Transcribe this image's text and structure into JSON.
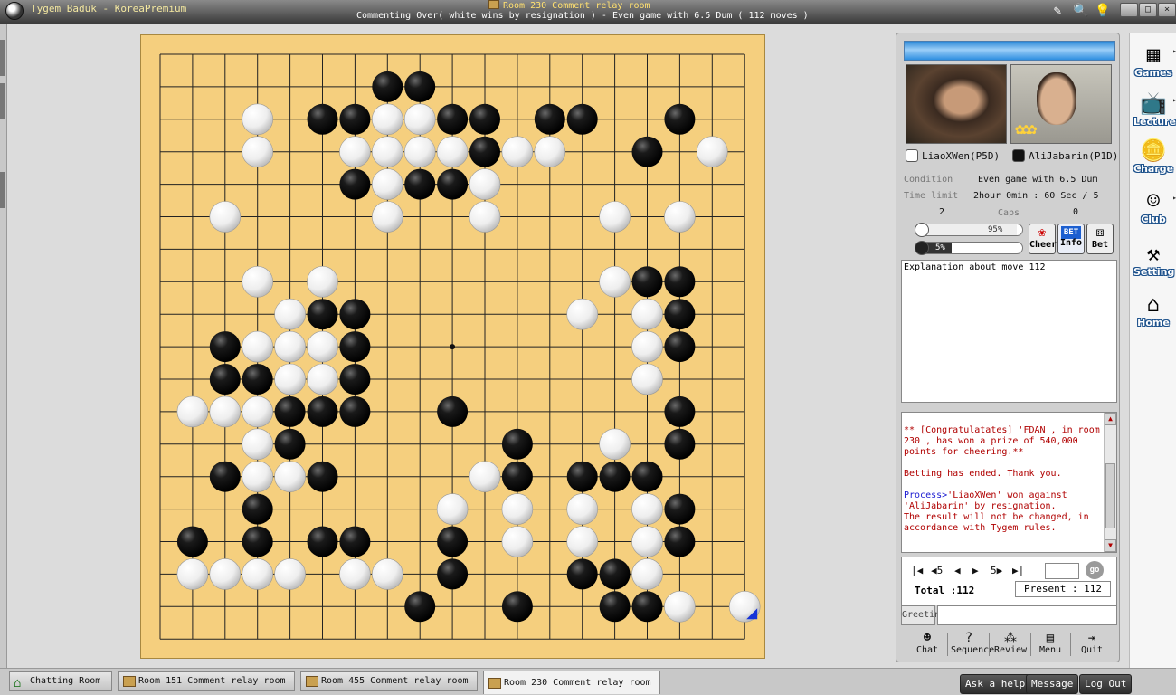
{
  "window": {
    "app_title": "Tygem Baduk - KoreaPremium",
    "room_title": "Room 230 Comment relay room",
    "status": "Commenting Over( white wins by resignation ) - Even game with 6.5 Dum  ( 112 moves )"
  },
  "players": {
    "white": {
      "name": "LiaoXWen(P5D)",
      "captures": "2",
      "cheer_pct": "95%"
    },
    "black": {
      "name": "AliJabarin(P1D)",
      "captures": "0",
      "cheer_pct": "5%"
    }
  },
  "info": {
    "condition_label": "Condition",
    "condition_value": "Even game with 6.5 Dum",
    "time_label": "Time limit",
    "time_value": "2hour 0min : 60 Sec / 5",
    "caps_label": "Caps"
  },
  "side_buttons": {
    "cheer": "Cheer",
    "info": "Info",
    "bet": "Bet",
    "bet_badge": "BET"
  },
  "explanation": "Explanation about move 112",
  "chat": {
    "line1": "** [Congratulatates] 'FDAN', in room 230 , has won a prize of 540,000 points for cheering.**",
    "line2": "Betting has ended. Thank you.",
    "process_label": "Process>",
    "line3": "'LiaoXWen' won against 'AliJabarin' by resignation.",
    "line4": "The result will not be changed, in accordance with Tygem rules."
  },
  "nav": {
    "first": "|◀",
    "back5": "◀5",
    "back": "◀",
    "fwd": "▶",
    "fwd5": "5▶",
    "last": "▶|",
    "go": "go",
    "total": "Total :112",
    "present": "Present : 112"
  },
  "greeting": {
    "label": "Greeting"
  },
  "bottom_buttons": [
    "Chat",
    "Sequence",
    "Review",
    "Menu",
    "Quit"
  ],
  "menu": [
    "Games",
    "Lecture",
    "Charge",
    "Club",
    "Setting",
    "Home"
  ],
  "tabs": [
    "Chatting Room",
    "Room 151 Comment relay room",
    "Room 455 Comment relay room",
    "Room 230 Comment relay room"
  ],
  "tab_active": "Room 230 Comment relay room",
  "right_buttons": [
    "Ask a help",
    "Message",
    "Log Out"
  ],
  "icons": {
    "app": "baduk-stone-icon",
    "pen": "pen-icon",
    "search": "search-icon",
    "tip": "lightbulb-icon"
  },
  "colors": {
    "board": "#f5cf7e",
    "header_blue": "#2e8ad8",
    "chat_red": "#b00000",
    "chat_blue": "#1a1ad0"
  },
  "board": {
    "size": 19,
    "black": [
      [
        7,
        1
      ],
      [
        8,
        1
      ],
      [
        5,
        2
      ],
      [
        6,
        2
      ],
      [
        9,
        2
      ],
      [
        10,
        2
      ],
      [
        12,
        2
      ],
      [
        13,
        2
      ],
      [
        16,
        2
      ],
      [
        10,
        3
      ],
      [
        15,
        3
      ],
      [
        6,
        4
      ],
      [
        8,
        4
      ],
      [
        9,
        4
      ],
      [
        15,
        7
      ],
      [
        16,
        7
      ],
      [
        5,
        8
      ],
      [
        6,
        8
      ],
      [
        16,
        8
      ],
      [
        2,
        9
      ],
      [
        6,
        9
      ],
      [
        16,
        9
      ],
      [
        2,
        10
      ],
      [
        3,
        10
      ],
      [
        6,
        10
      ],
      [
        4,
        11
      ],
      [
        5,
        11
      ],
      [
        6,
        11
      ],
      [
        9,
        11
      ],
      [
        16,
        11
      ],
      [
        4,
        12
      ],
      [
        11,
        12
      ],
      [
        16,
        12
      ],
      [
        2,
        13
      ],
      [
        5,
        13
      ],
      [
        11,
        13
      ],
      [
        13,
        13
      ],
      [
        14,
        13
      ],
      [
        15,
        13
      ],
      [
        3,
        14
      ],
      [
        16,
        14
      ],
      [
        1,
        15
      ],
      [
        3,
        15
      ],
      [
        5,
        15
      ],
      [
        6,
        15
      ],
      [
        9,
        15
      ],
      [
        16,
        15
      ],
      [
        9,
        16
      ],
      [
        13,
        16
      ],
      [
        14,
        16
      ],
      [
        8,
        17
      ],
      [
        11,
        17
      ],
      [
        14,
        17
      ],
      [
        15,
        17
      ]
    ],
    "white": [
      [
        3,
        2
      ],
      [
        7,
        2
      ],
      [
        8,
        2
      ],
      [
        3,
        3
      ],
      [
        6,
        3
      ],
      [
        7,
        3
      ],
      [
        8,
        3
      ],
      [
        9,
        3
      ],
      [
        11,
        3
      ],
      [
        12,
        3
      ],
      [
        17,
        3
      ],
      [
        7,
        4
      ],
      [
        10,
        4
      ],
      [
        2,
        5
      ],
      [
        7,
        5
      ],
      [
        10,
        5
      ],
      [
        14,
        5
      ],
      [
        16,
        5
      ],
      [
        3,
        7
      ],
      [
        5,
        7
      ],
      [
        14,
        7
      ],
      [
        4,
        8
      ],
      [
        13,
        8
      ],
      [
        15,
        8
      ],
      [
        3,
        9
      ],
      [
        4,
        9
      ],
      [
        5,
        9
      ],
      [
        15,
        9
      ],
      [
        4,
        10
      ],
      [
        5,
        10
      ],
      [
        15,
        10
      ],
      [
        1,
        11
      ],
      [
        2,
        11
      ],
      [
        3,
        11
      ],
      [
        3,
        12
      ],
      [
        14,
        12
      ],
      [
        3,
        13
      ],
      [
        4,
        13
      ],
      [
        10,
        13
      ],
      [
        9,
        14
      ],
      [
        11,
        14
      ],
      [
        13,
        14
      ],
      [
        15,
        14
      ],
      [
        11,
        15
      ],
      [
        13,
        15
      ],
      [
        15,
        15
      ],
      [
        1,
        16
      ],
      [
        2,
        16
      ],
      [
        3,
        16
      ],
      [
        4,
        16
      ],
      [
        6,
        16
      ],
      [
        7,
        16
      ],
      [
        15,
        16
      ],
      [
        16,
        17
      ],
      [
        18,
        17
      ]
    ],
    "last_move": [
      18,
      17
    ],
    "hoshi": [
      [
        9,
        9
      ]
    ]
  }
}
